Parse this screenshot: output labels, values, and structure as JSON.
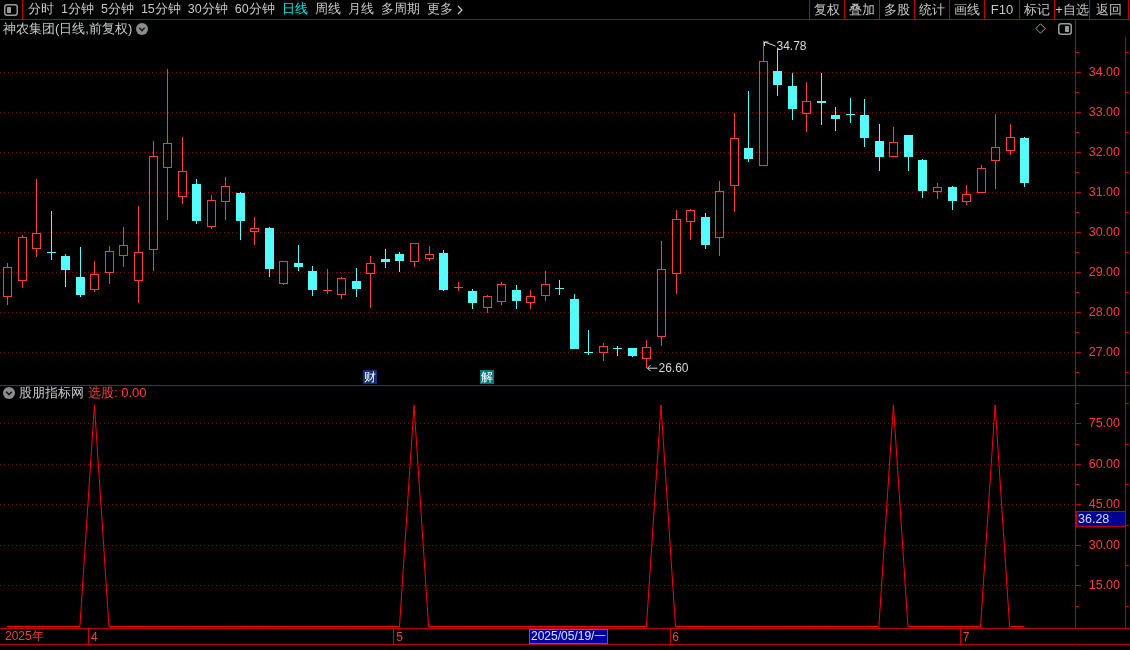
{
  "toolbar": {
    "tabs": [
      {
        "label": "分时",
        "kind": "period",
        "selected": false
      },
      {
        "label": "1分钟",
        "kind": "period",
        "selected": false
      },
      {
        "label": "5分钟",
        "kind": "period",
        "selected": false
      },
      {
        "label": "15分钟",
        "kind": "period",
        "selected": false
      },
      {
        "label": "30分钟",
        "kind": "period",
        "selected": false
      },
      {
        "label": "60分钟",
        "kind": "period",
        "selected": false
      },
      {
        "label": "日线",
        "kind": "period",
        "selected": true
      },
      {
        "label": "周线",
        "kind": "period",
        "selected": false
      },
      {
        "label": "月线",
        "kind": "period",
        "selected": false
      },
      {
        "label": "多周期",
        "kind": "period",
        "selected": false
      },
      {
        "label": "更多",
        "kind": "menu",
        "selected": false
      }
    ],
    "actions": [
      "复权",
      "叠加",
      "多股",
      "统计",
      "画线",
      "F10",
      "标记",
      "+自选",
      "返回"
    ]
  },
  "price_pane": {
    "title": "神农集团(日线,前复权)",
    "events": [
      {
        "label": "财",
        "color": "#12307a"
      },
      {
        "label": "解",
        "color": "#007a7a"
      }
    ],
    "chart_data": {
      "type": "candlestick",
      "ohlc": [
        [
          28.38,
          29.22,
          28.19,
          29.14
        ],
        [
          28.77,
          29.92,
          28.61,
          29.89
        ],
        [
          29.59,
          31.34,
          29.39,
          29.99
        ],
        [
          29.5,
          30.52,
          29.3,
          29.48
        ],
        [
          29.41,
          29.46,
          28.64,
          29.05
        ],
        [
          28.88,
          29.62,
          28.37,
          28.42
        ],
        [
          28.55,
          29.28,
          28.5,
          28.95
        ],
        [
          28.98,
          29.65,
          28.7,
          29.52
        ],
        [
          29.4,
          30.12,
          29.12,
          29.67
        ],
        [
          28.79,
          30.66,
          28.24,
          29.5
        ],
        [
          29.55,
          32.29,
          29.02,
          31.9
        ],
        [
          31.6,
          34.07,
          30.31,
          32.23
        ],
        [
          30.89,
          32.38,
          30.7,
          31.53
        ],
        [
          31.21,
          31.34,
          30.2,
          30.29
        ],
        [
          30.13,
          30.92,
          30.07,
          30.81
        ],
        [
          30.76,
          31.39,
          30.31,
          31.15
        ],
        [
          30.98,
          31.0,
          29.81,
          30.29
        ],
        [
          30.0,
          30.38,
          29.67,
          30.1
        ],
        [
          30.11,
          30.12,
          28.88,
          29.07
        ],
        [
          28.7,
          29.29,
          28.67,
          29.27
        ],
        [
          29.22,
          29.67,
          29.04,
          29.13
        ],
        [
          29.02,
          29.16,
          28.4,
          28.56
        ],
        [
          28.54,
          29.07,
          28.45,
          28.56
        ],
        [
          28.43,
          28.88,
          28.33,
          28.86
        ],
        [
          28.79,
          29.11,
          28.37,
          28.59
        ],
        [
          28.95,
          29.41,
          28.11,
          29.23
        ],
        [
          29.34,
          29.57,
          29.11,
          29.25
        ],
        [
          29.46,
          29.51,
          29.0,
          29.28
        ],
        [
          29.25,
          29.74,
          29.14,
          29.73
        ],
        [
          29.33,
          29.65,
          29.27,
          29.46
        ],
        [
          29.48,
          29.55,
          28.54,
          28.56
        ],
        [
          28.6,
          28.75,
          28.54,
          28.62
        ],
        [
          28.53,
          28.58,
          28.08,
          28.22
        ],
        [
          28.1,
          28.42,
          27.98,
          28.4
        ],
        [
          28.26,
          28.75,
          28.19,
          28.7
        ],
        [
          28.56,
          28.67,
          28.08,
          28.27
        ],
        [
          28.22,
          28.56,
          28.08,
          28.4
        ],
        [
          28.4,
          29.02,
          28.29,
          28.7
        ],
        [
          28.61,
          28.81,
          28.42,
          28.59
        ],
        [
          28.32,
          28.45,
          27.07,
          27.09
        ],
        [
          27.01,
          27.55,
          26.94,
          26.99
        ],
        [
          26.98,
          27.22,
          26.79,
          27.16
        ],
        [
          27.1,
          27.16,
          26.91,
          27.08
        ],
        [
          27.1,
          27.11,
          26.87,
          26.9
        ],
        [
          26.82,
          27.3,
          26.6,
          27.12
        ],
        [
          27.39,
          29.78,
          27.16,
          29.07
        ],
        [
          28.95,
          30.56,
          28.45,
          30.33
        ],
        [
          30.25,
          30.57,
          29.8,
          30.56
        ],
        [
          30.39,
          30.48,
          29.58,
          29.69
        ],
        [
          29.85,
          31.27,
          29.41,
          31.02
        ],
        [
          31.15,
          32.98,
          30.51,
          32.36
        ],
        [
          32.11,
          33.52,
          31.75,
          31.84
        ],
        [
          31.66,
          34.78,
          31.66,
          34.27
        ],
        [
          34.04,
          34.58,
          33.4,
          33.69
        ],
        [
          33.66,
          33.99,
          32.81,
          33.09
        ],
        [
          32.95,
          33.76,
          32.5,
          33.29
        ],
        [
          33.27,
          33.97,
          32.67,
          33.22
        ],
        [
          32.92,
          33.12,
          32.53,
          32.83
        ],
        [
          32.95,
          33.35,
          32.73,
          32.93
        ],
        [
          32.92,
          33.33,
          32.13,
          32.36
        ],
        [
          32.28,
          32.71,
          31.53,
          31.89
        ],
        [
          31.89,
          32.64,
          31.88,
          32.25
        ],
        [
          32.43,
          32.44,
          31.53,
          31.89
        ],
        [
          31.81,
          31.82,
          30.85,
          31.02
        ],
        [
          31.01,
          31.24,
          30.82,
          31.13
        ],
        [
          31.13,
          31.15,
          30.56,
          30.78
        ],
        [
          30.75,
          31.18,
          30.67,
          30.95
        ],
        [
          30.99,
          31.68,
          30.98,
          31.6
        ],
        [
          31.77,
          32.95,
          31.08,
          32.14
        ],
        [
          32.02,
          32.71,
          31.94,
          32.37
        ],
        [
          32.36,
          32.37,
          31.12,
          31.24
        ],
        null,
        null,
        null
      ],
      "ylim": [
        26.18,
        34.88
      ],
      "yticks": [
        {
          "value": 34,
          "label": "34.00"
        },
        {
          "value": 33,
          "label": "33.00"
        },
        {
          "value": 32,
          "label": "32.00"
        },
        {
          "value": 31,
          "label": "31.00"
        },
        {
          "value": 30,
          "label": "30.00"
        },
        {
          "value": 29,
          "label": "29.00"
        },
        {
          "value": 28,
          "label": "28.00"
        },
        {
          "value": 27,
          "label": "27.00"
        }
      ],
      "grid": true,
      "annotations": [
        "34.78",
        "26.60"
      ]
    }
  },
  "indicator_pane": {
    "name": "股朋指标网",
    "reading": "选股: 0.00",
    "cursor_value": "36.28",
    "chart_data": {
      "type": "line",
      "categories": [
        null,
        null,
        null,
        null,
        null,
        null,
        "4",
        null,
        null,
        null,
        null,
        null,
        null,
        null,
        null,
        null,
        null,
        null,
        null,
        null,
        null,
        null,
        null,
        null,
        null,
        null,
        null,
        "5",
        null,
        null,
        null,
        null,
        null,
        null,
        null,
        null,
        null,
        null,
        null,
        null,
        null,
        null,
        null,
        null,
        null,
        null,
        "6",
        null,
        null,
        null,
        null,
        null,
        null,
        null,
        null,
        null,
        null,
        null,
        null,
        null,
        null,
        null,
        null,
        null,
        null,
        null,
        "7",
        null,
        null,
        null,
        null,
        null,
        null,
        null
      ],
      "values": [
        0,
        0,
        0,
        0,
        0,
        0,
        82,
        0,
        0,
        0,
        0,
        0,
        0,
        0,
        0,
        0,
        0,
        0,
        0,
        0,
        0,
        0,
        0,
        0,
        0,
        0,
        0,
        0,
        82,
        0,
        0,
        0,
        0,
        0,
        0,
        0,
        0,
        0,
        0,
        0,
        0,
        0,
        0,
        0,
        0,
        82,
        0,
        0,
        0,
        0,
        0,
        0,
        0,
        0,
        0,
        0,
        0,
        0,
        0,
        0,
        0,
        82,
        0,
        0,
        0,
        0,
        0,
        0,
        82,
        0,
        0,
        null,
        null,
        null
      ],
      "color": "#ff0000",
      "ylim": [
        -1.1,
        89.2
      ],
      "yticks": [
        {
          "value": 75,
          "label": "75.00"
        },
        {
          "value": 60,
          "label": "60.00"
        },
        {
          "value": 45,
          "label": "45.00"
        },
        {
          "value": 30,
          "label": "30.00"
        },
        {
          "value": 15,
          "label": "15.00"
        }
      ],
      "grid": true
    }
  },
  "time_axis": {
    "year": "2025年",
    "cursor_date": "2025/05/19/一"
  }
}
